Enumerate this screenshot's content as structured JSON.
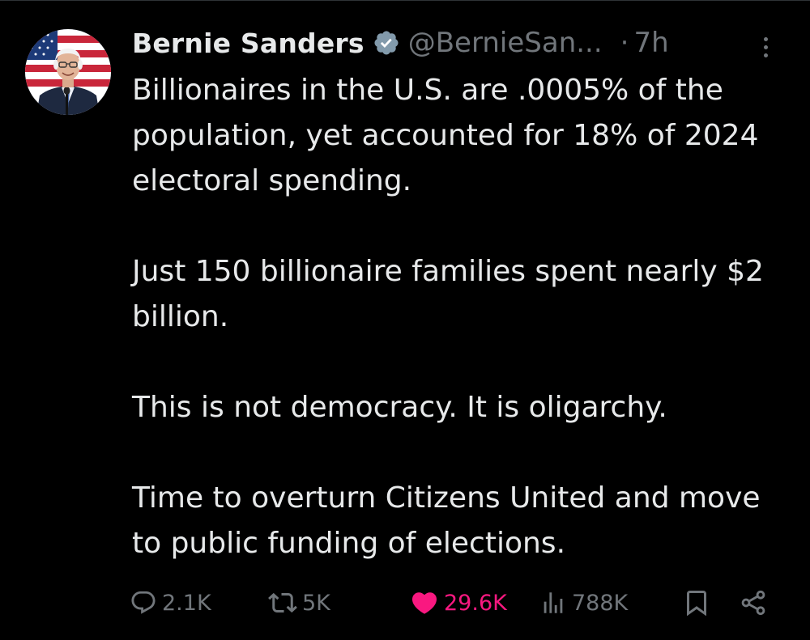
{
  "tweet": {
    "display_name": "Bernie Sanders",
    "handle": "@BernieSan...",
    "separator": "·",
    "time": "7h",
    "paragraphs": [
      "Billionaires in the U.S. are .0005% of the population, yet accounted for 18% of 2024 electoral spending.",
      "Just 150 billionaire families spent nearly $2 billion.",
      "This is not democracy. It is oligarchy.",
      "Time to overturn Citizens United and move to public funding of elections."
    ]
  },
  "actions": {
    "replies": "2.1K",
    "reposts": "5K",
    "likes": "29.6K",
    "views": "788K"
  },
  "icons": {
    "verified": "verified-badge-icon",
    "more": "more-options-icon",
    "reply": "reply-icon",
    "repost": "repost-icon",
    "like": "heart-icon",
    "views": "views-icon",
    "bookmark": "bookmark-icon",
    "share": "share-icon"
  },
  "colors": {
    "background": "#000000",
    "text": "#e7e9ea",
    "muted": "#71767b",
    "like_active": "#f91880",
    "verified": "#829aab"
  }
}
